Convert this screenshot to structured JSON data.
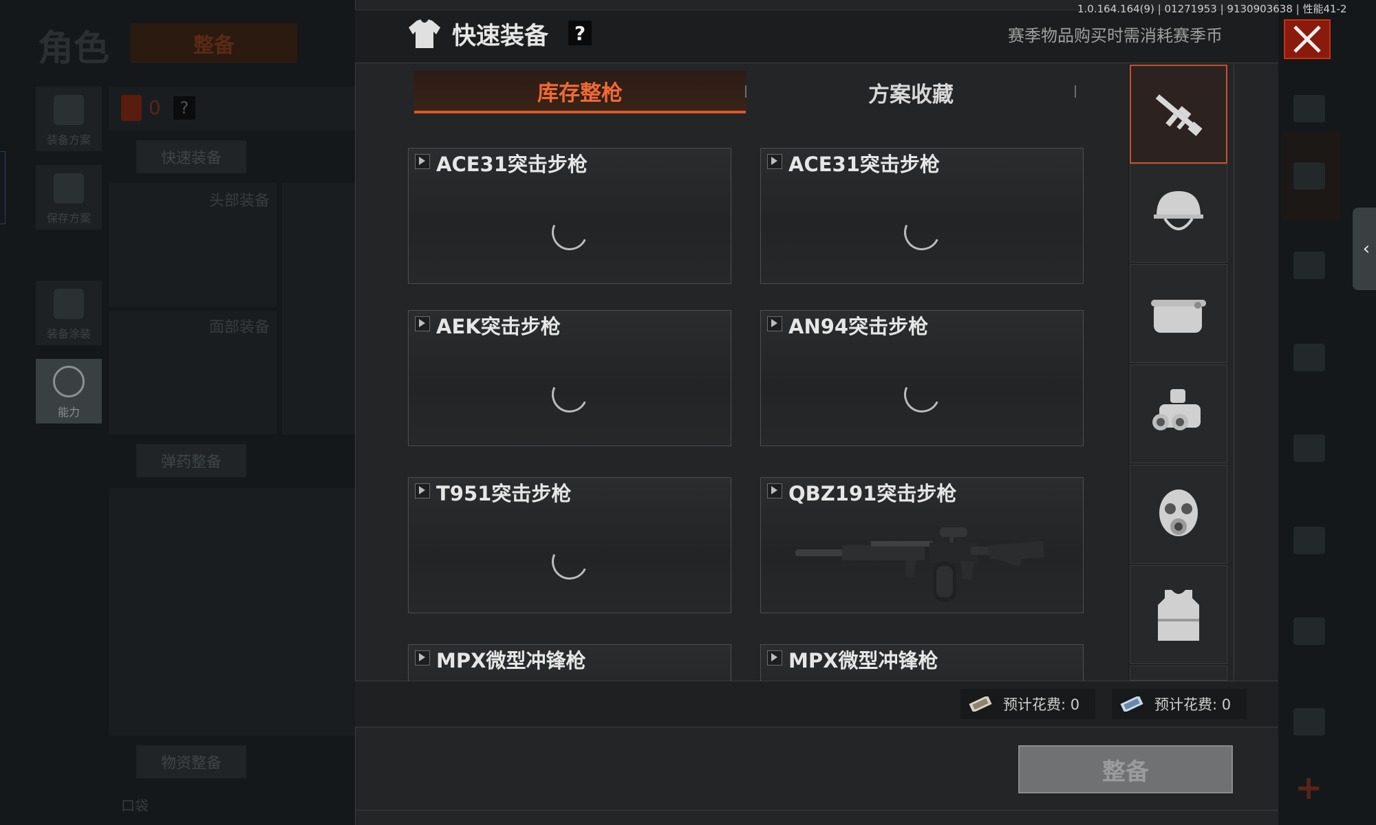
{
  "background": {
    "title": "角色",
    "tab": "整备",
    "side_items": [
      {
        "label": "装备方案",
        "icon": "equipment-plan-icon"
      },
      {
        "label": "保存方案",
        "icon": "save-plan-icon"
      },
      {
        "label": "装备涂装",
        "icon": "equipment-skin-icon"
      },
      {
        "label": "能力",
        "icon": "ability-icon"
      }
    ],
    "bag_count": "0",
    "bag_help": "?",
    "quick_equip": "快速装备",
    "head_gear": "头部装备",
    "face_gear": "面部装备",
    "ammo_prep": "弹药整备",
    "supply_prep": "物资整备",
    "pocket": "口袋"
  },
  "version": "1.0.164.164(9) | 01271953 | 9130903638 | 性能41-2",
  "modal": {
    "title": "快速装备",
    "help": "?",
    "note": "赛季物品购买时需消耗赛季币",
    "tabs": [
      {
        "label": "库存整枪",
        "active": true
      },
      {
        "label": "方案收藏",
        "active": false
      }
    ],
    "items": [
      {
        "name": "ACE31突击步枪",
        "state": "loading"
      },
      {
        "name": "ACE31突击步枪",
        "state": "loading"
      },
      {
        "name": "AEK突击步枪",
        "state": "loading"
      },
      {
        "name": "AN94突击步枪",
        "state": "loading"
      },
      {
        "name": "T951突击步枪",
        "state": "loading"
      },
      {
        "name": "QBZ191突击步枪",
        "state": "image"
      },
      {
        "name": "MPX微型冲锋枪",
        "state": "loading"
      },
      {
        "name": "MPX微型冲锋枪",
        "state": "loading"
      }
    ],
    "categories": [
      {
        "icon": "rifle-icon",
        "active": true
      },
      {
        "icon": "helmet-icon",
        "active": false
      },
      {
        "icon": "face-mask-icon",
        "active": false
      },
      {
        "icon": "night-vision-icon",
        "active": false
      },
      {
        "icon": "gas-mask-icon",
        "active": false
      },
      {
        "icon": "body-armor-icon",
        "active": false
      }
    ],
    "costs": [
      {
        "label": "预计花费: 0",
        "icon": "banknote-icon"
      },
      {
        "label": "预计花费: 0",
        "icon": "season-coin-icon"
      }
    ],
    "equip_button": "整备"
  },
  "colors": {
    "accent": "#d85a2a",
    "close": "#8a1a0c"
  }
}
